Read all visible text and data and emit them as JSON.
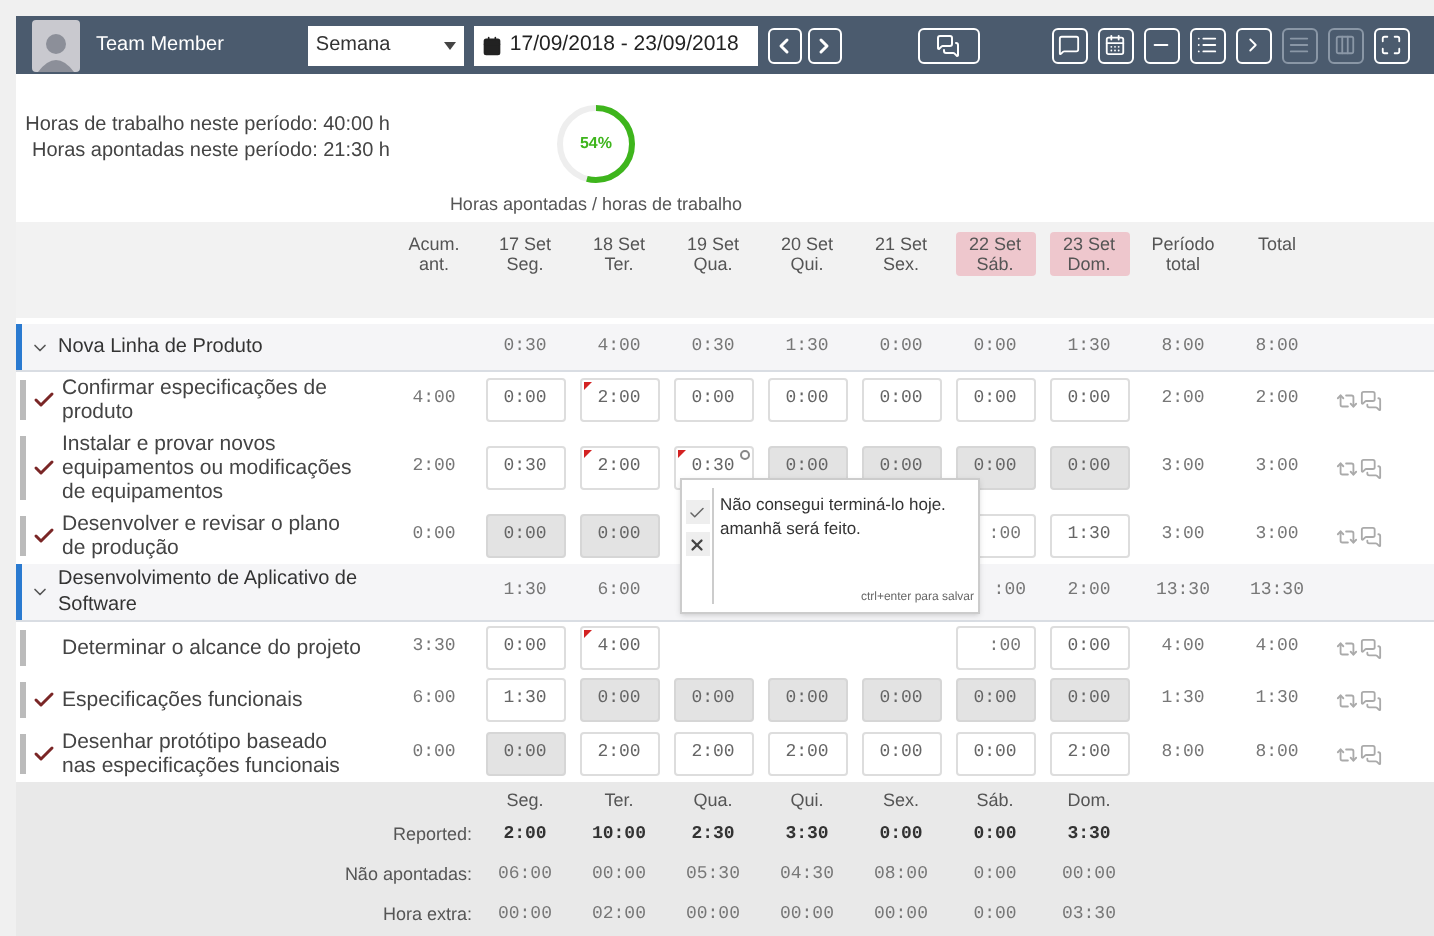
{
  "topbar": {
    "user": "Team Member",
    "period_select": "Semana",
    "date_range": "17/09/2018 - 23/09/2018",
    "toolbar": [
      {
        "kind": "comment",
        "disabled": false
      },
      {
        "kind": "calendar",
        "disabled": false
      },
      {
        "kind": "collapse",
        "disabled": false
      },
      {
        "kind": "list",
        "disabled": false
      },
      {
        "kind": "next",
        "disabled": false
      },
      {
        "kind": "rows",
        "disabled": true
      },
      {
        "kind": "columns",
        "disabled": true
      },
      {
        "kind": "fullscreen",
        "disabled": false
      }
    ]
  },
  "summary": {
    "lines": [
      "Horas de trabalho neste período: 40:00 h",
      "Horas apontadas neste período: 21:30 h"
    ],
    "gauge": {
      "level": 0.54,
      "label": "54%",
      "caption": "Horas apontadas / horas de trabalho"
    }
  },
  "columns": [
    {
      "line1": "Acum.",
      "line2": "ant.",
      "weekend": false
    },
    {
      "line1": "17 Set",
      "line2": "Seg.",
      "weekend": false
    },
    {
      "line1": "18 Set",
      "line2": "Ter.",
      "weekend": false
    },
    {
      "line1": "19 Set",
      "line2": "Qua.",
      "weekend": false
    },
    {
      "line1": "20 Set",
      "line2": "Qui.",
      "weekend": false
    },
    {
      "line1": "21 Set",
      "line2": "Sex.",
      "weekend": false
    },
    {
      "line1": "22 Set",
      "line2": "Sáb.",
      "weekend": true
    },
    {
      "line1": "23 Set",
      "line2": "Dom.",
      "weekend": true
    },
    {
      "line1": "Período",
      "line2": "total",
      "weekend": false
    },
    {
      "line1": "Total",
      "weekend": false
    }
  ],
  "groups": [
    {
      "name": "Nova Linha de Produto",
      "expanded": true,
      "cells": [
        {
          "kind": "text",
          "value": "0:30"
        },
        {
          "kind": "text",
          "value": "4:00"
        },
        {
          "kind": "text",
          "value": "0:30"
        },
        {
          "kind": "text",
          "value": "1:30"
        },
        {
          "kind": "text",
          "value": "0:00"
        },
        {
          "kind": "text",
          "value": "0:00"
        },
        {
          "kind": "text",
          "value": "1:30"
        }
      ],
      "period": "8:00",
      "total": "8:00",
      "tasks": [
        {
          "label": "Confirmar especificações de produto",
          "checked": true,
          "acum": "4:00",
          "period": "2:00",
          "total": "2:00",
          "cells": [
            {
              "kind": "input",
              "value": "0:00",
              "disabled": false,
              "flag": false,
              "note": false
            },
            {
              "kind": "input",
              "value": "2:00",
              "disabled": false,
              "flag": true,
              "note": false
            },
            {
              "kind": "input",
              "value": "0:00",
              "disabled": false,
              "flag": false,
              "note": false
            },
            {
              "kind": "input",
              "value": "0:00",
              "disabled": false,
              "flag": false,
              "note": false
            },
            {
              "kind": "input",
              "value": "0:00",
              "disabled": false,
              "flag": false,
              "note": false
            },
            {
              "kind": "input",
              "value": "0:00",
              "disabled": false,
              "flag": false,
              "note": false
            },
            {
              "kind": "input",
              "value": "0:00",
              "disabled": false,
              "flag": false,
              "note": false
            }
          ]
        },
        {
          "label": "Instalar e provar novos equipamentos ou modificações de equipamentos",
          "checked": true,
          "acum": "2:00",
          "period": "3:00",
          "total": "3:00",
          "cells": [
            {
              "kind": "input",
              "value": "0:30",
              "disabled": false,
              "flag": false,
              "note": false
            },
            {
              "kind": "input",
              "value": "2:00",
              "disabled": false,
              "flag": true,
              "note": false
            },
            {
              "kind": "input",
              "value": "0:30",
              "disabled": false,
              "flag": true,
              "note": true
            },
            {
              "kind": "input",
              "value": "0:00",
              "disabled": true,
              "flag": false,
              "note": false
            },
            {
              "kind": "input",
              "value": "0:00",
              "disabled": true,
              "flag": false,
              "note": false
            },
            {
              "kind": "input",
              "value": "0:00",
              "disabled": true,
              "flag": false,
              "note": false
            },
            {
              "kind": "input",
              "value": "0:00",
              "disabled": true,
              "flag": false,
              "note": false
            }
          ]
        },
        {
          "label": "Desenvolver e revisar o plano de produção",
          "checked": true,
          "acum": "0:00",
          "period": "3:00",
          "total": "3:00",
          "cells": [
            {
              "kind": "input",
              "value": "0:00",
              "disabled": true,
              "flag": false,
              "note": false
            },
            {
              "kind": "input",
              "value": "0:00",
              "disabled": true,
              "flag": false,
              "note": false
            },
            {
              "kind": "hidden"
            },
            {
              "kind": "hidden"
            },
            {
              "kind": "hidden"
            },
            {
              "kind": "partial",
              "value": ":00"
            },
            {
              "kind": "input",
              "value": "1:30",
              "disabled": false,
              "flag": false,
              "note": false
            }
          ]
        }
      ]
    },
    {
      "name": "Desenvolvimento de Aplicativo de Software",
      "expanded": true,
      "cells": [
        {
          "kind": "text",
          "value": "1:30"
        },
        {
          "kind": "text",
          "value": "6:00"
        },
        {
          "kind": "hidden"
        },
        {
          "kind": "hidden"
        },
        {
          "kind": "hidden"
        },
        {
          "kind": "partial_text",
          "value": ":00"
        },
        {
          "kind": "text",
          "value": "2:00"
        }
      ],
      "period": "13:30",
      "total": "13:30",
      "tasks": [
        {
          "label": "Determinar o alcance do projeto",
          "checked": false,
          "acum": "3:30",
          "period": "4:00",
          "total": "4:00",
          "cells": [
            {
              "kind": "input",
              "value": "0:00",
              "disabled": false,
              "flag": false,
              "note": false
            },
            {
              "kind": "input",
              "value": "4:00",
              "disabled": false,
              "flag": true,
              "note": false
            },
            {
              "kind": "hidden"
            },
            {
              "kind": "hidden"
            },
            {
              "kind": "hidden"
            },
            {
              "kind": "partial",
              "value": ":00"
            },
            {
              "kind": "input",
              "value": "0:00",
              "disabled": false,
              "flag": false,
              "note": false
            }
          ]
        },
        {
          "label": "Especificações funcionais",
          "checked": true,
          "acum": "6:00",
          "period": "1:30",
          "total": "1:30",
          "cells": [
            {
              "kind": "input",
              "value": "1:30",
              "disabled": false,
              "flag": false,
              "note": false
            },
            {
              "kind": "input",
              "value": "0:00",
              "disabled": true,
              "flag": false,
              "note": false
            },
            {
              "kind": "input",
              "value": "0:00",
              "disabled": true,
              "flag": false,
              "note": false
            },
            {
              "kind": "input",
              "value": "0:00",
              "disabled": true,
              "flag": false,
              "note": false
            },
            {
              "kind": "input",
              "value": "0:00",
              "disabled": true,
              "flag": false,
              "note": false
            },
            {
              "kind": "input",
              "value": "0:00",
              "disabled": true,
              "flag": false,
              "note": false
            },
            {
              "kind": "input",
              "value": "0:00",
              "disabled": true,
              "flag": false,
              "note": false
            }
          ]
        },
        {
          "label": "Desenhar protótipo baseado nas especificações funcionais",
          "checked": true,
          "acum": "0:00",
          "period": "8:00",
          "total": "8:00",
          "cells": [
            {
              "kind": "input",
              "value": "0:00",
              "disabled": true,
              "flag": false,
              "note": false
            },
            {
              "kind": "input",
              "value": "2:00",
              "disabled": false,
              "flag": false,
              "note": false
            },
            {
              "kind": "input",
              "value": "2:00",
              "disabled": false,
              "flag": false,
              "note": false
            },
            {
              "kind": "input",
              "value": "2:00",
              "disabled": false,
              "flag": false,
              "note": false
            },
            {
              "kind": "input",
              "value": "0:00",
              "disabled": false,
              "flag": false,
              "note": false
            },
            {
              "kind": "input",
              "value": "0:00",
              "disabled": false,
              "flag": false,
              "note": false
            },
            {
              "kind": "input",
              "value": "2:00",
              "disabled": false,
              "flag": false,
              "note": false
            }
          ]
        }
      ]
    }
  ],
  "comment_popup": {
    "text": "Não consegui terminá-lo hoje.\namanhã será feito.",
    "hint": "ctrl+enter para salvar"
  },
  "footer": {
    "days": [
      "Seg.",
      "Ter.",
      "Qua.",
      "Qui.",
      "Sex.",
      "Sáb.",
      "Dom."
    ],
    "rows": [
      {
        "label": "Reported:",
        "bold": true,
        "values": [
          "2:00",
          "10:00",
          "2:30",
          "3:30",
          "0:00",
          "0:00",
          "3:30"
        ]
      },
      {
        "label": "Não apontadas:",
        "bold": false,
        "values": [
          "06:00",
          "00:00",
          "05:30",
          "04:30",
          "08:00",
          "0:00",
          "00:00"
        ]
      },
      {
        "label": "Hora extra:",
        "bold": false,
        "values": [
          "00:00",
          "02:00",
          "00:00",
          "00:00",
          "00:00",
          "0:00",
          "03:30"
        ]
      }
    ]
  }
}
